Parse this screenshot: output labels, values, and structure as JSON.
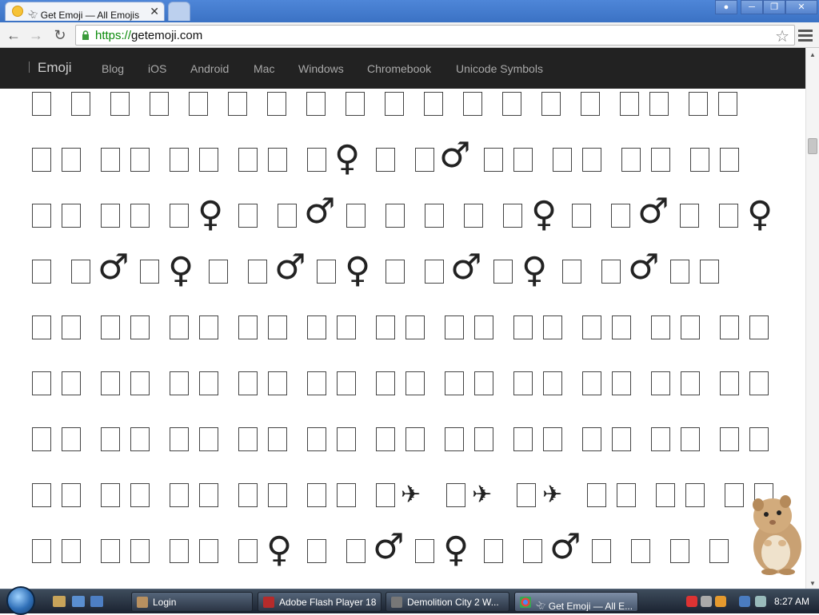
{
  "browser": {
    "tab_title": "𓄀 Get Emoji — All Emojis",
    "tab_close": "✕",
    "url_scheme": "https://",
    "url_host": "getemoji.com"
  },
  "nav": {
    "brand": "Emoji",
    "links": [
      "Blog",
      "iOS",
      "Android",
      "Mac",
      "Windows",
      "Chromebook",
      "Unicode Symbols"
    ]
  },
  "glyphs": {
    "venus": "♀",
    "mars": "♂",
    "plane": "✈"
  },
  "taskbar": {
    "items": [
      "Login",
      "Adobe Flash Player 18",
      "Demolition City 2 W...",
      "𓄀 Get Emoji — All E..."
    ],
    "clock": "8:27 AM"
  },
  "icons": {
    "back": "back-arrow-icon",
    "forward": "forward-arrow-icon",
    "reload": "reload-icon",
    "lock": "lock-icon",
    "star": "star-icon",
    "menu": "hamburger-menu-icon"
  },
  "colors": {
    "nav_bg": "#222222",
    "url_green": "#0a8a0a",
    "titlebar": "#3b72c4"
  }
}
